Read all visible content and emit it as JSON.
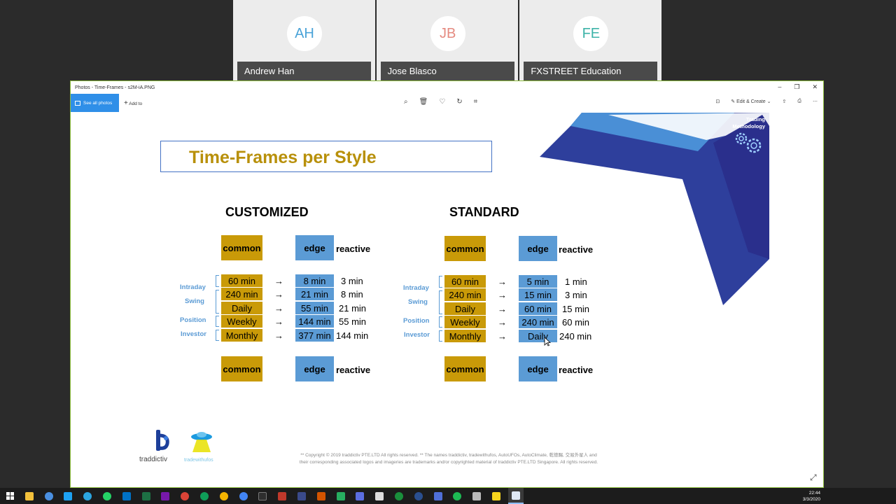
{
  "participants": [
    {
      "initials": "AH",
      "name": "Andrew Han",
      "color": "#4aa3d8"
    },
    {
      "initials": "JB",
      "name": "Jose Blasco",
      "color": "#e58a80"
    },
    {
      "initials": "FE",
      "name": "FXSTREET Education",
      "color": "#3db3a8"
    }
  ],
  "window": {
    "title": "Photos - Time-Frames - s2M-iA.PNG",
    "see_all_label": "See all photos",
    "add_to_label": "Add to",
    "edit_create_label": "Edit & Create"
  },
  "slide": {
    "title": "Time-Frames per Style",
    "brand": {
      "line1": "Trading",
      "line2": "Methodology"
    },
    "customized": {
      "heading": "CUSTOMIZED",
      "header": {
        "common": "common",
        "edge": "edge",
        "reactive": "reactive"
      },
      "rows": [
        {
          "common": "60 min",
          "edge": "8 min",
          "reactive": "3 min"
        },
        {
          "common": "240 min",
          "edge": "21 min",
          "reactive": "8 min"
        },
        {
          "common": "Daily",
          "edge": "55 min",
          "reactive": "21 min"
        },
        {
          "common": "Weekly",
          "edge": "144 min",
          "reactive": "55 min"
        },
        {
          "common": "Monthly",
          "edge": "377 min",
          "reactive": "144 min"
        }
      ],
      "footer": {
        "common": "common",
        "edge": "edge",
        "reactive": "reactive"
      }
    },
    "standard": {
      "heading": "STANDARD",
      "header": {
        "common": "common",
        "edge": "edge",
        "reactive": "reactive"
      },
      "rows": [
        {
          "common": "60 min",
          "edge": "5 min",
          "reactive": "1 min"
        },
        {
          "common": "240 min",
          "edge": "15 min",
          "reactive": "3 min"
        },
        {
          "common": "Daily",
          "edge": "60 min",
          "reactive": "15 min"
        },
        {
          "common": "Weekly",
          "edge": "240 min",
          "reactive": "60 min"
        },
        {
          "common": "Monthly",
          "edge": "Daily",
          "reactive": "240 min"
        }
      ],
      "footer": {
        "common": "common",
        "edge": "edge",
        "reactive": "reactive"
      }
    },
    "styles": {
      "intraday": "Intraday",
      "swing": "Swing",
      "position": "Position",
      "investor": "Investor"
    },
    "arrow": "→",
    "logos": {
      "left": "traddictiv",
      "right": "tradewithufos"
    },
    "footer_line1": "** Copyright © 2019 traddictiv PTE.LTD All rights reserved. **   The names traddictiv, tradewithufos, AutoUFOs, AutoClimate, 乾德賜, 交易外星人 and",
    "footer_line2": "their corresponding associated logos and imageries are trademarks and/or copyrighted material of traddictiv PTE.LTD Singapore. All rights reserved."
  },
  "taskbar": {
    "time": "22:44",
    "date": "3/3/2020"
  }
}
